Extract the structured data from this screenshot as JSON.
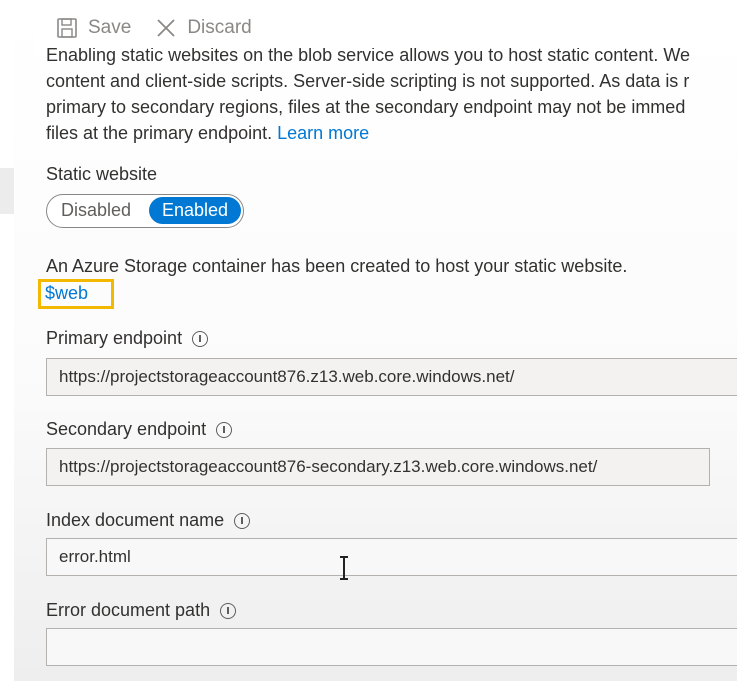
{
  "toolbar": {
    "save_label": "Save",
    "discard_label": "Discard"
  },
  "intro": {
    "line1": "Enabling static websites on the blob service allows you to host static content. We",
    "line2": "content and client-side scripts. Server-side scripting is not supported. As data is r",
    "line3": "primary to secondary regions, files at the secondary endpoint may not be immed",
    "line4": "files at the primary endpoint.",
    "learn_more": "Learn more"
  },
  "static_website": {
    "label": "Static website",
    "options": [
      "Disabled",
      "Enabled"
    ],
    "selected": "Enabled"
  },
  "container_note": "An Azure Storage container has been created to host your static website.",
  "container_link": "$web",
  "fields": {
    "primary_endpoint": {
      "label": "Primary endpoint",
      "value": "https://projectstorageaccount876.z13.web.core.windows.net/"
    },
    "secondary_endpoint": {
      "label": "Secondary endpoint",
      "value": "https://projectstorageaccount876-secondary.z13.web.core.windows.net/"
    },
    "index_document": {
      "label": "Index document name",
      "value": "error.html"
    },
    "error_document": {
      "label": "Error document path",
      "value": ""
    }
  },
  "icons": {
    "save": "save-icon",
    "discard": "close-icon",
    "info": "info-icon",
    "cursor": "text-cursor-icon"
  },
  "colors": {
    "accent": "#0078d4",
    "highlight_border": "#f3b800"
  }
}
